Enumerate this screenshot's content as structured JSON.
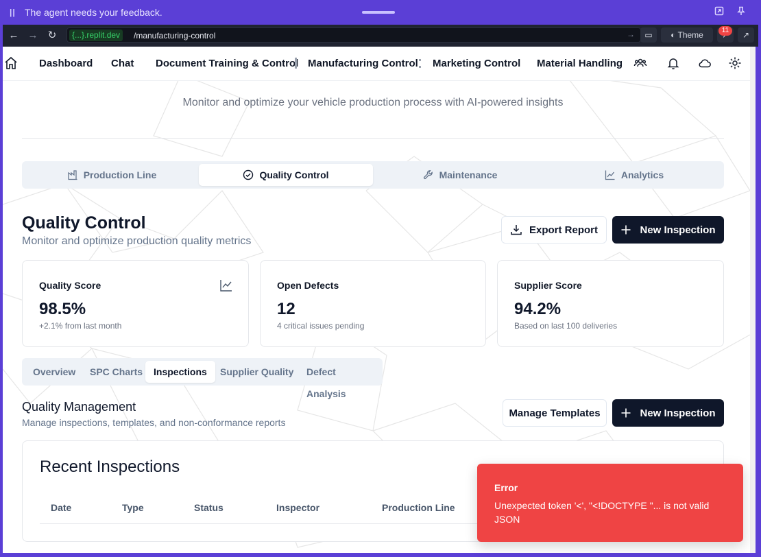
{
  "agent_bar": {
    "message": "The agent needs your feedback."
  },
  "browser": {
    "domain": "{...}.replit.dev",
    "path": "/manufacturing-control",
    "theme_label": "Theme",
    "badge_count": "11"
  },
  "nav": {
    "items": [
      "Dashboard",
      "Chat",
      "Document Training & Control",
      "Manufacturing Control",
      "Marketing Control",
      "Material Handling"
    ]
  },
  "page": {
    "subtitle": "Monitor and optimize your vehicle production process with AI-powered insights",
    "tabs": [
      "Production Line",
      "Quality Control",
      "Maintenance",
      "Analytics"
    ],
    "active_tab": "Quality Control",
    "title": "Quality Control",
    "title_sub": "Monitor and optimize production quality metrics",
    "export_label": "Export Report",
    "new_inspection_label": "New Inspection"
  },
  "cards": [
    {
      "title": "Quality Score",
      "value": "98.5%",
      "sub": "+2.1% from last month"
    },
    {
      "title": "Open Defects",
      "value": "12",
      "sub": "4 critical issues pending"
    },
    {
      "title": "Supplier Score",
      "value": "94.2%",
      "sub": "Based on last 100 deliveries"
    }
  ],
  "subtabs": [
    "Overview",
    "SPC Charts",
    "Inspections",
    "Supplier Quality",
    "Defect Analysis"
  ],
  "active_subtab": "Inspections",
  "management": {
    "title": "Quality Management",
    "sub": "Manage inspections, templates, and non-conformance reports",
    "templates_label": "Manage Templates",
    "new_inspection_label": "New Inspection"
  },
  "recent": {
    "title": "Recent Inspections",
    "columns": [
      "Date",
      "Type",
      "Status",
      "Inspector",
      "Production Line"
    ]
  },
  "toast": {
    "title": "Error",
    "message": "Unexpected token '<', \"<!DOCTYPE \"... is not valid JSON"
  }
}
